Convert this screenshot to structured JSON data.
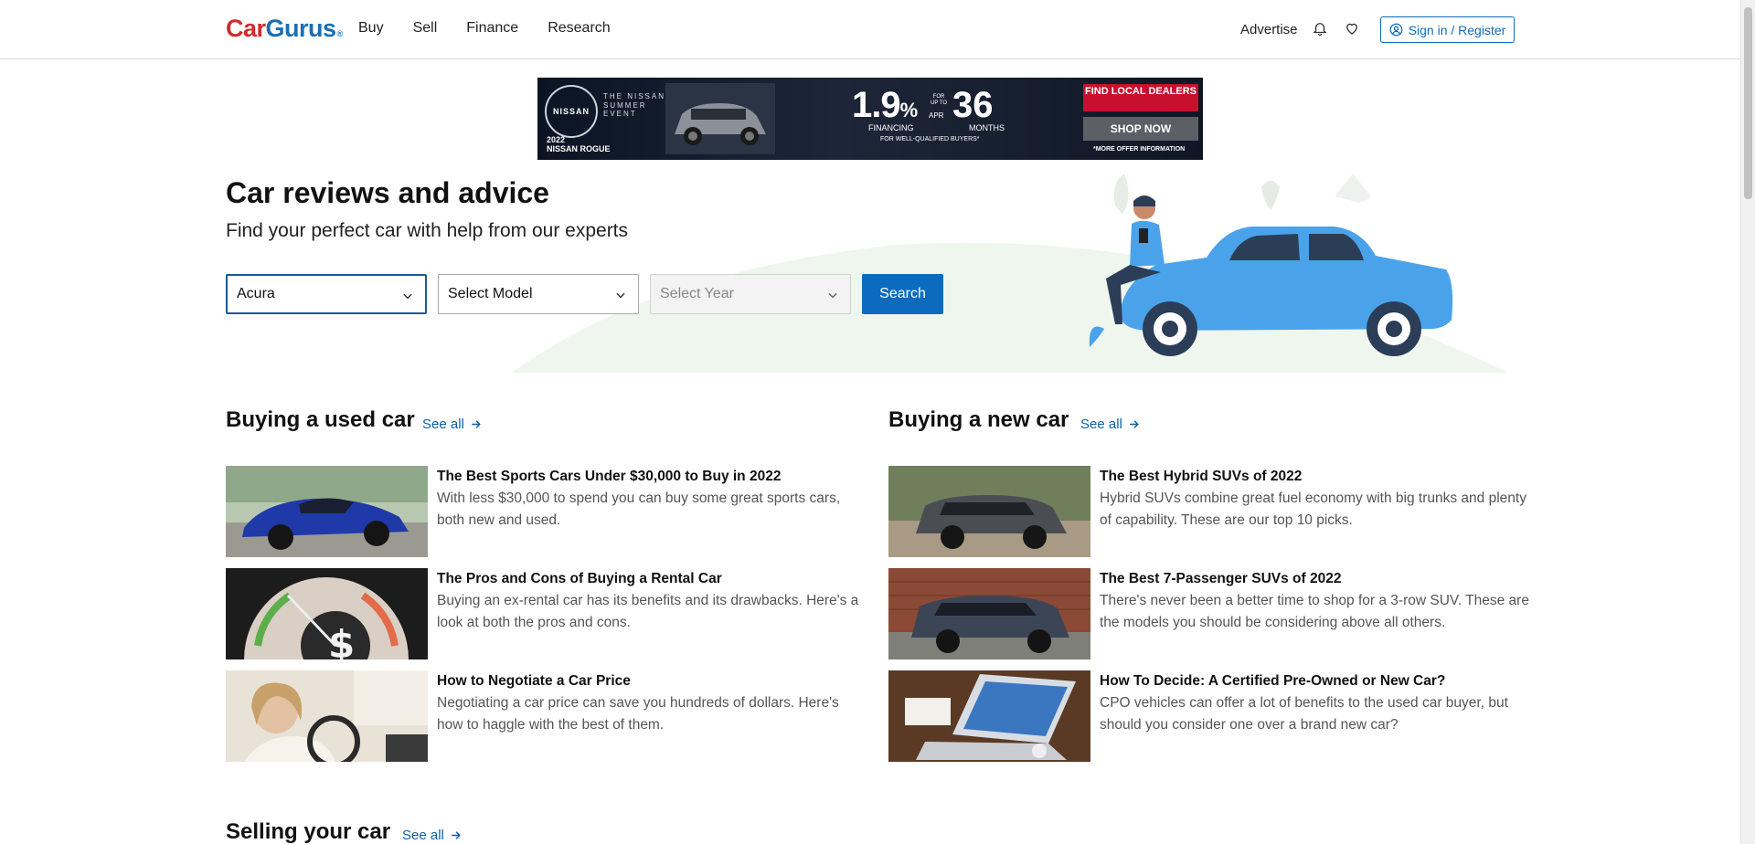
{
  "header": {
    "logo_car": "Car",
    "logo_gurus": "Gurus",
    "logo_mark": "®",
    "nav": [
      "Buy",
      "Sell",
      "Finance",
      "Research"
    ],
    "advertise": "Advertise",
    "signin": "Sign in / Register"
  },
  "ad": {
    "brand": "NISSAN",
    "event": "THE NISSAN SUMMER EVENT",
    "model_year": "2022",
    "model": "NISSAN ROGUE",
    "rate": "1.9",
    "rate_unit": "%",
    "apr": "APR",
    "financing": "FINANCING",
    "for_up_to": "FOR UP TO",
    "months_num": "36",
    "months": "MONTHS",
    "qualified": "FOR WELL-QUALIFIED BUYERS*",
    "find_dealers": "FIND LOCAL DEALERS",
    "shop_now": "SHOP NOW",
    "offer_info": "*MORE OFFER INFORMATION"
  },
  "hero": {
    "title": "Car reviews and advice",
    "subtitle": "Find your perfect car with help from our experts",
    "make_value": "Acura",
    "model_placeholder": "Select Model",
    "year_placeholder": "Select Year",
    "search_label": "Search"
  },
  "sections": {
    "used": {
      "title": "Buying a used car",
      "see_all": "See all",
      "articles": [
        {
          "title": "The Best Sports Cars Under $30,000 to Buy in 2022",
          "desc": "With less $30,000 to spend you can buy some great sports cars, both new and used."
        },
        {
          "title": "The Pros and Cons of Buying a Rental Car",
          "desc": "Buying an ex-rental car has its benefits and its drawbacks. Here's a look at both the pros and cons."
        },
        {
          "title": "How to Negotiate a Car Price",
          "desc": "Negotiating a car price can save you hundreds of dollars. Here's how to haggle with the best of them."
        }
      ]
    },
    "new": {
      "title": "Buying a new car",
      "see_all": "See all",
      "articles": [
        {
          "title": "The Best Hybrid SUVs of 2022",
          "desc": "Hybrid SUVs combine great fuel economy with big trunks and plenty of capability. These are our top 10 picks."
        },
        {
          "title": "The Best 7-Passenger SUVs of 2022",
          "desc": "There's never been a better time to shop for a 3-row SUV. These are the models you should be considering above all others."
        },
        {
          "title": "How To Decide: A Certified Pre-Owned or New Car?",
          "desc": "CPO vehicles can offer a lot of benefits to the used car buyer, but should you consider one over a brand new car?"
        }
      ]
    },
    "selling": {
      "title": "Selling your car",
      "see_all": "See all"
    }
  },
  "colors": {
    "brand_red": "#d12b2b",
    "brand_blue": "#1a6fb5",
    "action_blue": "#0d6bbf",
    "link_blue": "#0d5fa8"
  }
}
